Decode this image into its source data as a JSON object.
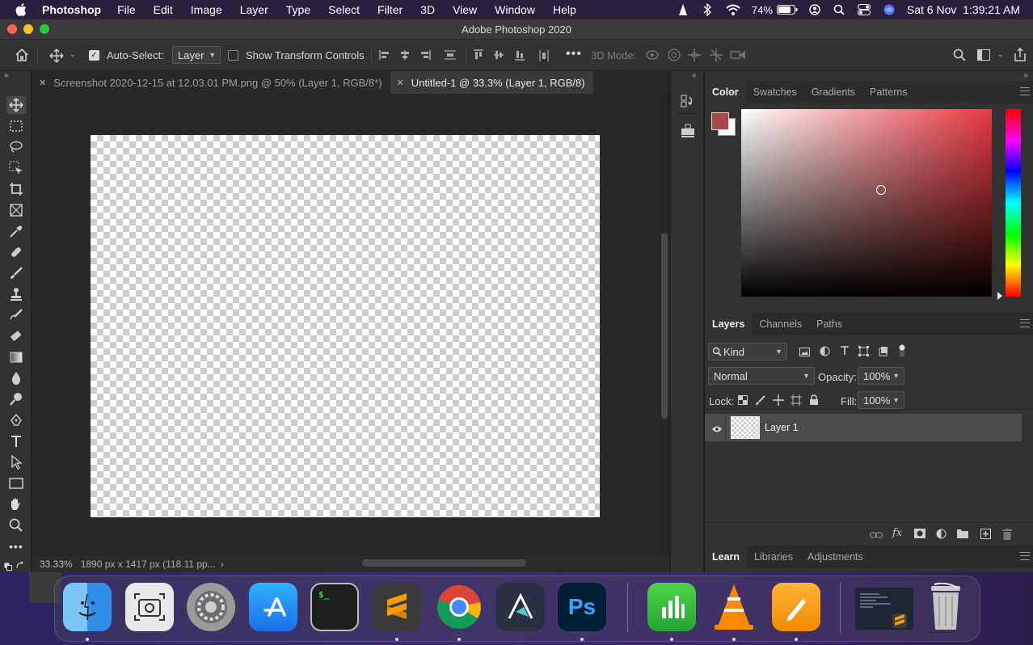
{
  "menubar": {
    "app": "Photoshop",
    "items": [
      "File",
      "Edit",
      "Image",
      "Layer",
      "Type",
      "Select",
      "Filter",
      "3D",
      "View",
      "Window",
      "Help"
    ],
    "battery": "74%",
    "clock": "Sat 6 Nov  1:39:21 AM"
  },
  "window": {
    "title": "Adobe Photoshop 2020"
  },
  "options": {
    "auto_select_label": "Auto-Select:",
    "auto_select_checked": true,
    "auto_select_value": "Layer",
    "transform_label": "Show Transform Controls",
    "mode_label": "3D Mode:"
  },
  "doc_tabs": [
    {
      "title": "Screenshot 2020-12-15 at 12.03.01 PM.png @ 50% (Layer 1, RGB/8*)",
      "active": false
    },
    {
      "title": "Untitled-1 @ 33.3% (Layer 1, RGB/8)",
      "active": true
    }
  ],
  "status": {
    "zoom": "33.33%",
    "info": "1890 px x 1417 px (118.11 pp...",
    "arrow": "›"
  },
  "color_panel": {
    "tabs": [
      "Color",
      "Swatches",
      "Gradients",
      "Patterns"
    ],
    "foreground": "#a84848",
    "background": "#ffffff"
  },
  "layers_panel": {
    "tabs": [
      "Layers",
      "Channels",
      "Paths"
    ],
    "filter": "Kind",
    "blend_mode": "Normal",
    "opacity_label": "Opacity:",
    "opacity": "100%",
    "lock_label": "Lock:",
    "fill_label": "Fill:",
    "fill": "100%",
    "layers": [
      {
        "name": "Layer 1",
        "visible": true
      }
    ]
  },
  "bottom_panel": {
    "tabs": [
      "Learn",
      "Libraries",
      "Adjustments"
    ]
  },
  "dock": {
    "apps": [
      "finder",
      "screenshot",
      "system-preferences",
      "app-store",
      "terminal",
      "sublime-text",
      "chrome",
      "affinity",
      "photoshop",
      "numbers",
      "vlc",
      "pages",
      "terminal-window",
      "trash"
    ],
    "ps_label": "Ps"
  }
}
